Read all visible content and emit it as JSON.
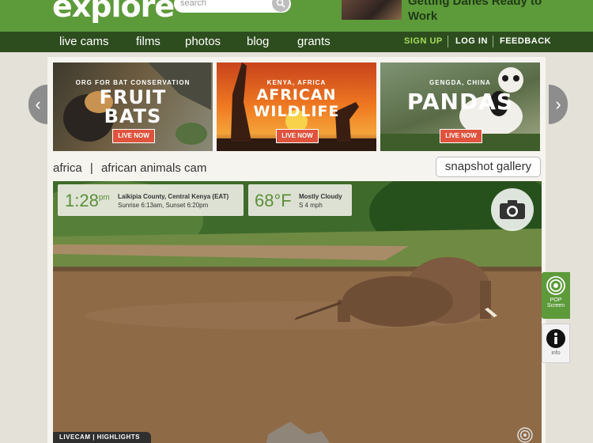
{
  "header": {
    "logo": "explore",
    "search_placeholder": "search",
    "promo": "Getting Danes Ready to Work"
  },
  "nav": {
    "items": [
      "live cams",
      "films",
      "photos",
      "blog",
      "grants"
    ],
    "sign_up": "SIGN UP",
    "log_in": "LOG IN",
    "feedback": "FEEDBACK"
  },
  "cards": [
    {
      "small": "ORG FOR BAT CONSERVATION",
      "big1": "FRUIT",
      "big2": "BATS",
      "live": "LIVE NOW"
    },
    {
      "small": "KENYA, AFRICA",
      "big1": "AFRICAN",
      "big2": "WILDLIFE",
      "live": "LIVE NOW"
    },
    {
      "small": "GENGDA, CHINA",
      "big1": "PANDAS",
      "big2": "",
      "live": "LIVE NOW"
    }
  ],
  "breadcrumb": {
    "first": "africa",
    "sep": "|",
    "second": "african animals cam"
  },
  "gallery_button": "snapshot gallery",
  "time": {
    "value": "1:28",
    "ampm": "pm",
    "location": "Laikipia County, Central Kenya (EAT)",
    "sun": "Sunrise 6:13am, Sunset 6:20pm"
  },
  "weather": {
    "temp": "68°F",
    "condition": "Mostly Cloudy",
    "wind": "S 4 mph"
  },
  "video_tag": "LIVECAM | HIGHLIGHTS",
  "side": {
    "pop_line1": "POP",
    "pop_line2": "Screen",
    "info": "info"
  }
}
